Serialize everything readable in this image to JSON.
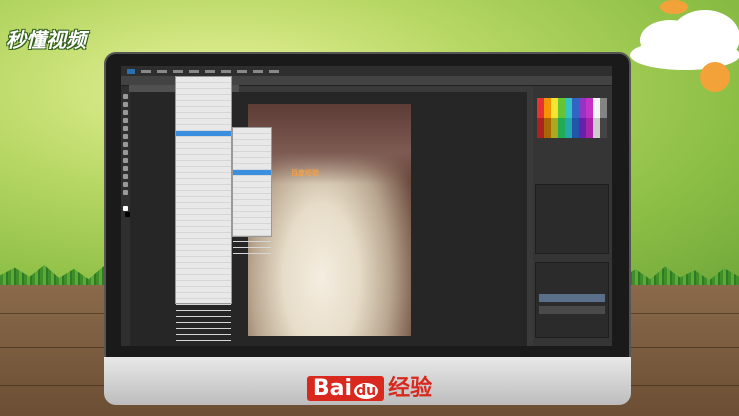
{
  "brand": {
    "logo_text": "秒懂视频",
    "footer_logo_bai": "Bai",
    "footer_logo_du": "du",
    "footer_logo_suffix": "经验"
  },
  "photoshop": {
    "menu_labels": [
      "",
      "",
      "",
      "",
      "",
      "",
      "",
      "",
      "",
      "",
      ""
    ],
    "watermark": "百度经验"
  },
  "colors": {
    "menu_highlight": "#3b8fe0",
    "watermark": "#f0a24a",
    "baidu_red": "#d9281e"
  }
}
